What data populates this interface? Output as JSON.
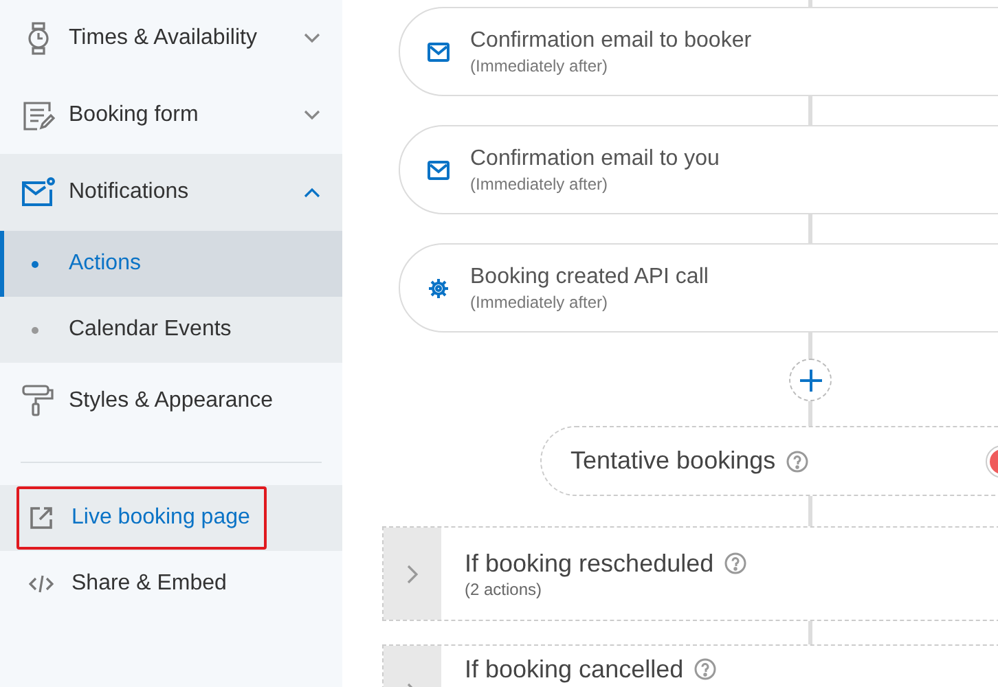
{
  "sidebar": {
    "items": [
      {
        "label": "Times & Availability",
        "expanded": false,
        "selected": false
      },
      {
        "label": "Booking form",
        "expanded": false,
        "selected": false
      },
      {
        "label": "Notifications",
        "expanded": true,
        "selected": true,
        "children": [
          {
            "label": "Actions",
            "selected": true
          },
          {
            "label": "Calendar Events",
            "selected": false
          }
        ]
      },
      {
        "label": "Styles & Appearance",
        "selected": false
      }
    ],
    "links": [
      {
        "label": "Live booking page",
        "highlighted": true
      },
      {
        "label": "Share & Embed",
        "highlighted": false
      }
    ]
  },
  "actions": [
    {
      "title": "Confirmation email to booker",
      "timing": "(Immediately after)",
      "kind": "email"
    },
    {
      "title": "Confirmation email to you",
      "timing": "(Immediately after)",
      "kind": "email"
    },
    {
      "title": "Booking created API call",
      "timing": "(Immediately after)",
      "kind": "api"
    }
  ],
  "tentative": {
    "label": "Tentative bookings",
    "on": false
  },
  "groups": [
    {
      "title": "If booking rescheduled",
      "count": "(2 actions)",
      "expanded": false
    },
    {
      "title": "If booking cancelled",
      "expanded": false
    }
  ]
}
